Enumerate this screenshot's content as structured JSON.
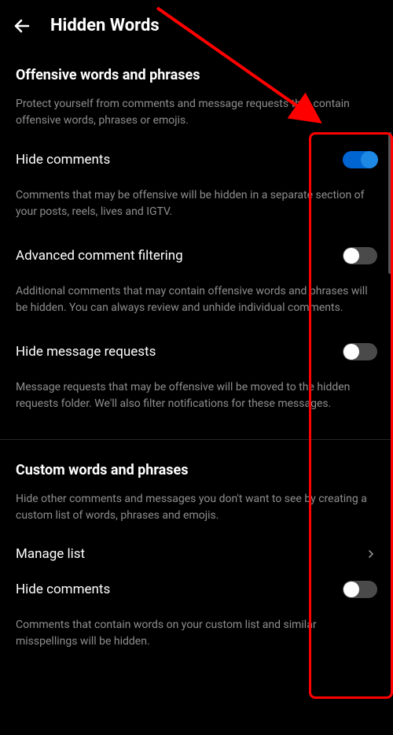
{
  "header": {
    "title": "Hidden Words"
  },
  "sections": {
    "offensive": {
      "title": "Offensive words and phrases",
      "description": "Protect yourself from comments and message requests that contain offensive words, phrases or emojis."
    },
    "custom": {
      "title": "Custom words and phrases",
      "description": "Hide other comments and messages you don't want to see by creating a custom list of words, phrases and emojis."
    }
  },
  "settings": {
    "hideComments": {
      "label": "Hide comments",
      "description": "Comments that may be offensive will be hidden in a separate section of your posts, reels, lives and IGTV.",
      "enabled": true
    },
    "advancedFiltering": {
      "label": "Advanced comment filtering",
      "description": "Additional comments that may contain offensive words and phrases will be hidden. You can always review and unhide individual comments.",
      "enabled": false
    },
    "hideMessageRequests": {
      "label": "Hide message requests",
      "description": "Message requests that may be offensive will be moved to the hidden requests folder. We'll also filter notifications for these messages.",
      "enabled": false
    },
    "manageList": {
      "label": "Manage list"
    },
    "hideCommentsCustom": {
      "label": "Hide comments",
      "description": "Comments that contain words on your custom list and similar misspellings will be hidden.",
      "enabled": false
    }
  },
  "annotation": {
    "highlight_color": "#ff0000",
    "arrow_color": "#ff0000"
  }
}
